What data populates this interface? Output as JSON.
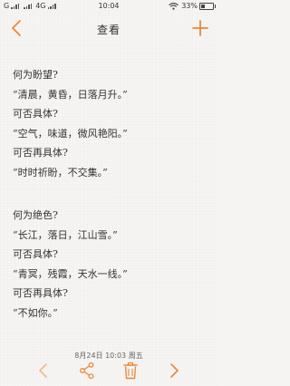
{
  "status_bar": {
    "left": "G",
    "network": "4G",
    "time": "10:04",
    "battery_text": "33%",
    "battery_level": 0.33
  },
  "header": {
    "title": "查看",
    "accent_color": "#e8893a"
  },
  "note": {
    "group1": [
      "何为盼望?",
      "“清晨，黄昏，日落月升。”",
      "可否具体?",
      "“空气，味道，微风艳阳。”",
      "可否再具体?",
      "“时时祈盼，不交集。”"
    ],
    "group2": [
      "何为绝色?",
      "“长江，落日，江山雪。”",
      "可否具体?",
      "“青冥，残霞，天水一线。”",
      "可否再具体?",
      "“不如你。”"
    ]
  },
  "footer": {
    "date": "8月24日 10:03 周五"
  },
  "icons": {
    "back": "chevron-left-icon",
    "add": "plus-icon",
    "prev": "chevron-left-icon",
    "share": "share-icon",
    "delete": "trash-icon",
    "next": "chevron-right-icon"
  }
}
